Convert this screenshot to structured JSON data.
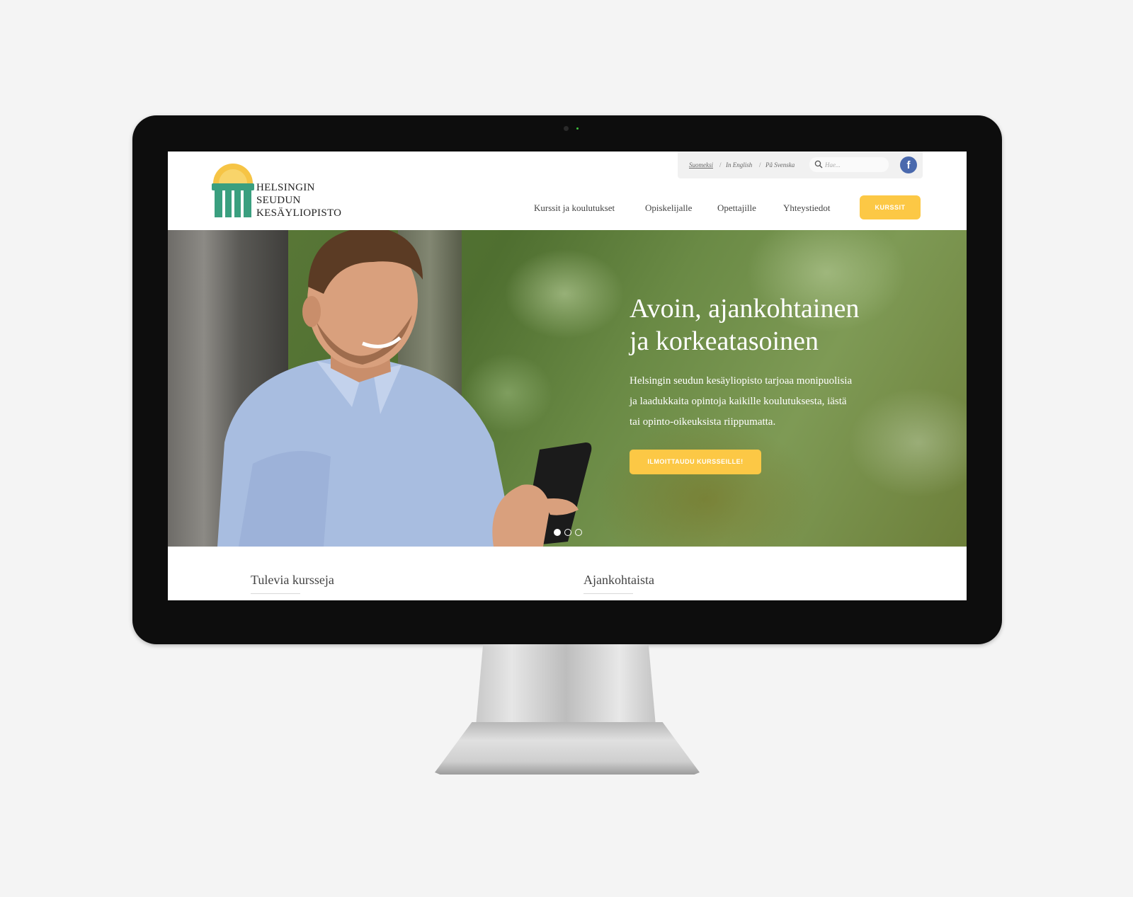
{
  "header": {
    "logo": {
      "lines": [
        "Helsingin",
        "Seudun",
        "Kesäyliopisto"
      ]
    },
    "languages": [
      {
        "label": "Suomeksi",
        "active": true
      },
      {
        "label": "In English",
        "active": false
      },
      {
        "label": "På Svenska",
        "active": false
      }
    ],
    "language_separator": "/",
    "search": {
      "placeholder": "Hae..."
    },
    "facebook_label": "f",
    "nav": [
      {
        "label": "Kurssit ja koulutukset"
      },
      {
        "label": "Opiskelijalle"
      },
      {
        "label": "Opettajille"
      },
      {
        "label": "Yhteystiedot"
      }
    ],
    "cta_label": "KURSSIT"
  },
  "hero": {
    "title_lines": [
      "Avoin, ajankohtainen",
      "ja korkeatasoinen"
    ],
    "text_lines": [
      "Helsingin seudun kesäyliopisto tarjoaa monipuolisia",
      "ja laadukkaita opintoja kaikille koulutuksesta, iästä",
      "tai opinto-oikeuksista riippumatta."
    ],
    "cta_label": "ILMOITTAUDU KURSSEILLE!",
    "slides": {
      "count": 3,
      "active": 1
    }
  },
  "sections": [
    {
      "title": "Tulevia kursseja"
    },
    {
      "title": "Ajankohtaista"
    }
  ],
  "colors": {
    "accent": "#fcc845",
    "logo_green": "#3a9f7f",
    "logo_sun": "#f6c445",
    "facebook": "#4a69ad",
    "bezel": "#0d0d0d",
    "background": "#f4f4f4"
  },
  "icons": [
    "search-icon",
    "facebook-icon",
    "logo-mark"
  ]
}
